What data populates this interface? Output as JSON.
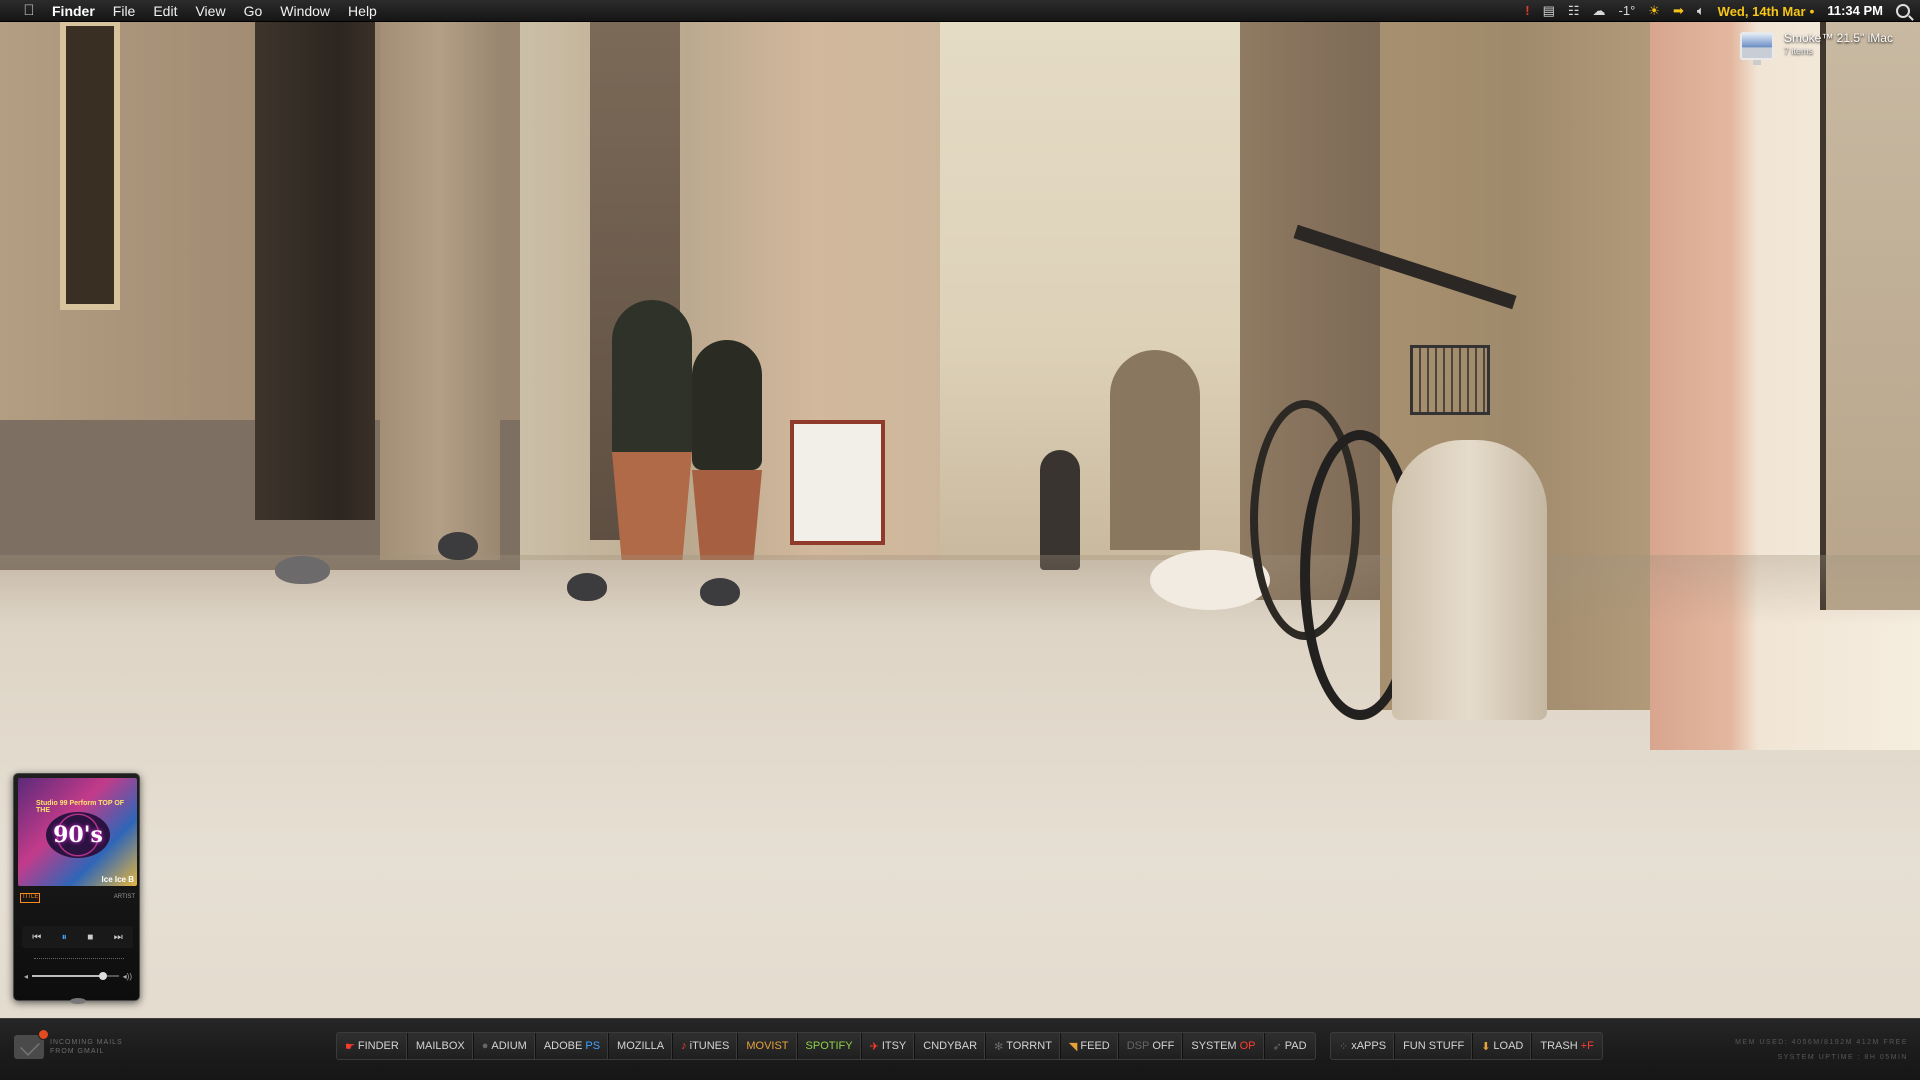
{
  "menubar": {
    "apple_glyph": "",
    "app_name": "Finder",
    "menus": [
      "File",
      "Edit",
      "View",
      "Go",
      "Window",
      "Help"
    ],
    "status": {
      "weather": "-1°",
      "date": "Wed, 14th Mar",
      "separator": "•",
      "time": "11:34 PM"
    }
  },
  "desktop_icon": {
    "name": "Smoke™ 21.5\" iMac",
    "sub": "7 items",
    "icon": "imac-icon"
  },
  "player": {
    "album_art_text": "90's",
    "album_caption": "Studio 99 Perform TOP OF THE",
    "now_playing": "Ice Ice B",
    "label_title": "TITLE",
    "label_artist": "ARTIST",
    "controls": {
      "prev": "⏮",
      "play_pause": "⏸",
      "stop": "■",
      "next": "⏭"
    },
    "volume_low": "◂",
    "volume_high": "◂))",
    "volume_level": 0.82
  },
  "dock": {
    "mail": {
      "line1": "incoming mails",
      "line2": "from gmail"
    },
    "group1": [
      {
        "label": "FINDER",
        "icon": "finder-icon",
        "glyph": "☛"
      },
      {
        "label": "MAILBOX",
        "icon": "",
        "glyph": ""
      },
      {
        "label": "ADIUM",
        "icon": "adium-icon",
        "glyph": "●"
      },
      {
        "label": "ADOBE",
        "icon": "",
        "glyph": "",
        "suffix": "PS"
      },
      {
        "label": "MOZILLA",
        "icon": "",
        "glyph": ""
      },
      {
        "label": "iTUNES",
        "icon": "music-note-icon",
        "glyph": "♪"
      },
      {
        "label": "MOVIST",
        "icon": "",
        "glyph": ""
      },
      {
        "label": "SPOTIFY",
        "icon": "spotify-icon",
        "glyph": ""
      },
      {
        "label": "ITSY",
        "icon": "twitter-bird-icon",
        "glyph": "✈"
      },
      {
        "label": "CNDYBAR",
        "icon": "",
        "glyph": ""
      },
      {
        "label": "TORRNT",
        "icon": "torrent-icon",
        "glyph": "✻"
      },
      {
        "label": "FEED",
        "icon": "rss-icon",
        "glyph": "◥"
      },
      {
        "label": "OFF",
        "icon": "",
        "glyph": "",
        "prefix": "DSP"
      },
      {
        "label": "SYSTEM",
        "icon": "",
        "glyph": "",
        "suffix": "OP"
      },
      {
        "label": "PAD",
        "icon": "rocket-icon",
        "glyph": "➶"
      }
    ],
    "group2": [
      {
        "label": "xAPPS",
        "icon": "grid-icon",
        "glyph": "⁘"
      },
      {
        "label": "FUN STUFF",
        "icon": "",
        "glyph": ""
      },
      {
        "label": "LOAD",
        "icon": "download-arrow-icon",
        "glyph": "⬇"
      },
      {
        "label": "TRASH",
        "icon": "",
        "glyph": "",
        "suffix": "+F"
      }
    ],
    "stats": {
      "line1": "mem used: 4056m/8192m 412m free",
      "line2": "system uptime :  8h 05min"
    }
  },
  "colors": {
    "accent_yellow": "#f5c518",
    "accent_orange": "#e8a23a",
    "accent_blue": "#3ea3ff",
    "accent_red": "#ff3b2d"
  }
}
